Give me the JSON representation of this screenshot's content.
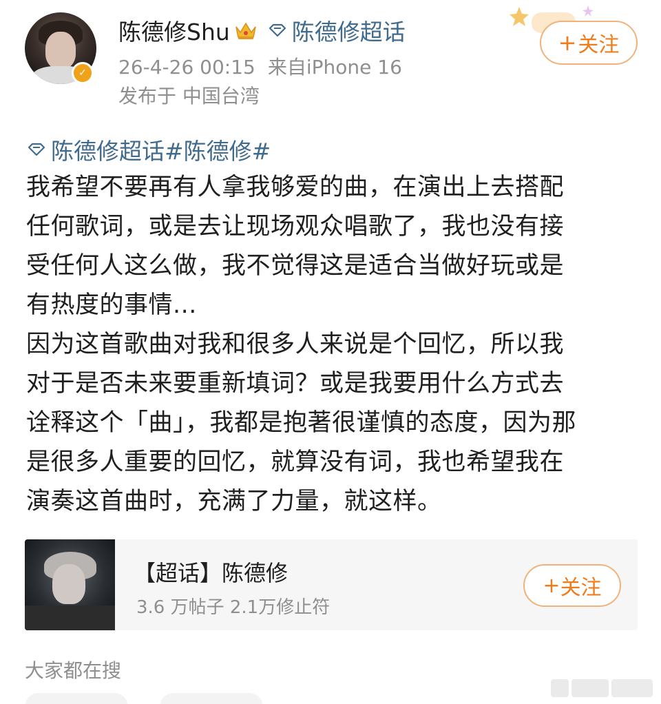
{
  "post": {
    "author": {
      "name": "陈德修Shu",
      "topic_name": "陈德修超话",
      "verified_icon": "verified-badge-icon",
      "crown_icon": "crown-icon"
    },
    "meta": {
      "timestamp": "26-4-26 00:15",
      "source": "来自iPhone 16",
      "location": "发布于 中国台湾"
    },
    "follow_button": {
      "plus": "+",
      "label": "关注"
    },
    "hashtag_line": "陈德修超话#陈德修#",
    "body_lines": [
      "我希望不要再有人拿我够爱的曲，在演出上去搭配",
      "任何歌词，或是去让现场观众唱歌了，我也没有接",
      "受任何人这么做，我不觉得这是适合当做好玩或是",
      "有热度的事情...",
      "因为这首歌曲对我和很多人来说是个回忆，所以我",
      "对于是否未来要重新填词？或是我要用什么方式去",
      "诠释这个「曲」，我都是抱著很谨慎的态度，因为那",
      "是很多人重要的回忆，就算没有词，我也希望我在",
      "演奏这首曲时，充满了力量，就这样。"
    ]
  },
  "topic_card": {
    "title": "【超话】陈德修",
    "stats": "3.6 万帖子 2.1万修止符",
    "follow_plus": "+",
    "follow_label": "关注"
  },
  "related": {
    "section_title": "大家都在搜"
  },
  "colors": {
    "link_blue": "#3f6b8f",
    "accent_orange": "#ef7b1a",
    "follow_border": "#f0b27a",
    "meta_gray": "#8f8f8f",
    "verified_orange": "#f0a21b"
  }
}
